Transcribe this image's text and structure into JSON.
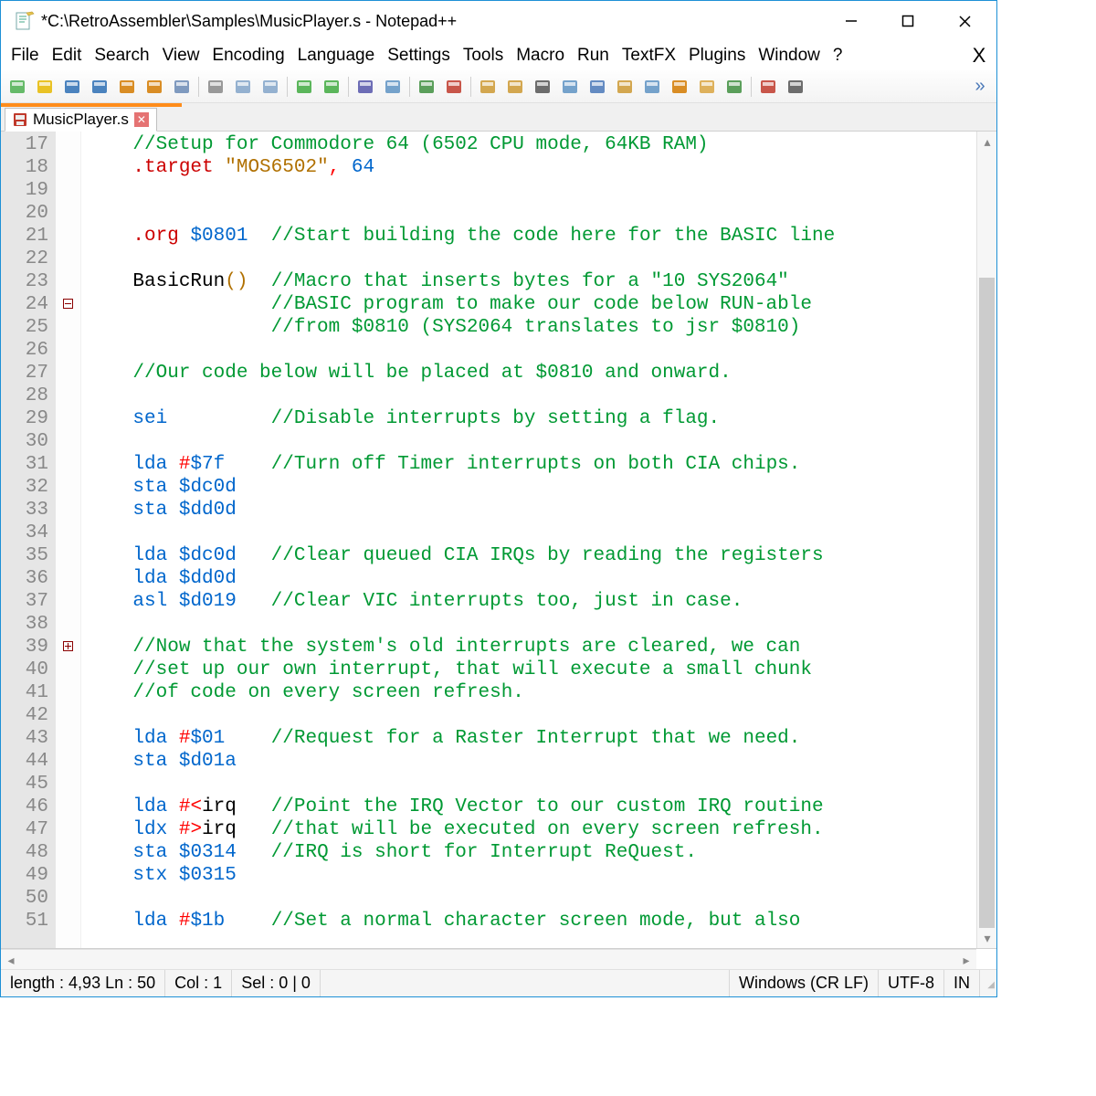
{
  "window": {
    "title": "*C:\\RetroAssembler\\Samples\\MusicPlayer.s - Notepad++"
  },
  "menu": {
    "items": [
      "File",
      "Edit",
      "Search",
      "View",
      "Encoding",
      "Language",
      "Settings",
      "Tools",
      "Macro",
      "Run",
      "TextFX",
      "Plugins",
      "Window",
      "?"
    ],
    "overflow": "X"
  },
  "toolbar": {
    "icons": [
      "new",
      "open",
      "save",
      "save-all",
      "close",
      "close-all",
      "print",
      "",
      "cut",
      "copy",
      "paste",
      "",
      "undo",
      "redo",
      "",
      "find",
      "replace",
      "",
      "zoom-in",
      "zoom-out",
      "",
      "sync-v",
      "sync-h",
      "wrap",
      "show-all",
      "indent-guides",
      "lang",
      "doc-map",
      "func-list",
      "folder-open",
      "monitor",
      "",
      "record",
      "stop"
    ],
    "overflowGlyph": "»"
  },
  "tab": {
    "name": "MusicPlayer.s"
  },
  "editor": {
    "firstLine": 17,
    "lineCount": 35,
    "foldMarkers": {
      "24": "collapsed",
      "39": "open"
    },
    "code": [
      [
        [
          "    ",
          ""
        ],
        [
          "//Setup for Commodore 64 (6502 CPU mode, 64KB RAM)",
          "cmt"
        ]
      ],
      [
        [
          "    ",
          ""
        ],
        [
          ".target",
          "dir"
        ],
        [
          " ",
          ""
        ],
        [
          "\"MOS6502\"",
          "str"
        ],
        [
          ", ",
          "op"
        ],
        [
          "64",
          "num"
        ]
      ],
      [],
      [],
      [
        [
          "    ",
          ""
        ],
        [
          ".org",
          "dir"
        ],
        [
          " ",
          ""
        ],
        [
          "$0801",
          "num"
        ],
        [
          "  ",
          ""
        ],
        [
          "//Start building the code here for the BASIC line",
          "cmt"
        ]
      ],
      [],
      [
        [
          "    ",
          ""
        ],
        [
          "BasicRun",
          "id"
        ],
        [
          "()",
          "paren"
        ],
        [
          "  ",
          ""
        ],
        [
          "//Macro that inserts bytes for a \"10 SYS2064\"",
          "cmt"
        ]
      ],
      [
        [
          "                ",
          ""
        ],
        [
          "//BASIC program to make our code below RUN-able",
          "cmt"
        ]
      ],
      [
        [
          "                ",
          ""
        ],
        [
          "//from $0810 (SYS2064 translates to jsr $0810)",
          "cmt"
        ]
      ],
      [],
      [
        [
          "    ",
          ""
        ],
        [
          "//Our code below will be placed at $0810 and onward.",
          "cmt"
        ]
      ],
      [],
      [
        [
          "    ",
          ""
        ],
        [
          "sei",
          "kw"
        ],
        [
          "         ",
          ""
        ],
        [
          "//Disable interrupts by setting a flag.",
          "cmt"
        ]
      ],
      [],
      [
        [
          "    ",
          ""
        ],
        [
          "lda",
          "kw"
        ],
        [
          " ",
          ""
        ],
        [
          "#",
          "op"
        ],
        [
          "$7f",
          "num"
        ],
        [
          "    ",
          ""
        ],
        [
          "//Turn off Timer interrupts on both CIA chips.",
          "cmt"
        ]
      ],
      [
        [
          "    ",
          ""
        ],
        [
          "sta",
          "kw"
        ],
        [
          " ",
          ""
        ],
        [
          "$dc0d",
          "num"
        ]
      ],
      [
        [
          "    ",
          ""
        ],
        [
          "sta",
          "kw"
        ],
        [
          " ",
          ""
        ],
        [
          "$dd0d",
          "num"
        ]
      ],
      [],
      [
        [
          "    ",
          ""
        ],
        [
          "lda",
          "kw"
        ],
        [
          " ",
          ""
        ],
        [
          "$dc0d",
          "num"
        ],
        [
          "   ",
          ""
        ],
        [
          "//Clear queued CIA IRQs by reading the registers",
          "cmt"
        ]
      ],
      [
        [
          "    ",
          ""
        ],
        [
          "lda",
          "kw"
        ],
        [
          " ",
          ""
        ],
        [
          "$dd0d",
          "num"
        ]
      ],
      [
        [
          "    ",
          ""
        ],
        [
          "asl",
          "kw"
        ],
        [
          " ",
          ""
        ],
        [
          "$d019",
          "num"
        ],
        [
          "   ",
          ""
        ],
        [
          "//Clear VIC interrupts too, just in case.",
          "cmt"
        ]
      ],
      [],
      [
        [
          "    ",
          ""
        ],
        [
          "//Now that the system's old interrupts are cleared, we can",
          "cmt"
        ]
      ],
      [
        [
          "    ",
          ""
        ],
        [
          "//set up our own interrupt, that will execute a small chunk",
          "cmt"
        ]
      ],
      [
        [
          "    ",
          ""
        ],
        [
          "//of code on every screen refresh.",
          "cmt"
        ]
      ],
      [],
      [
        [
          "    ",
          ""
        ],
        [
          "lda",
          "kw"
        ],
        [
          " ",
          ""
        ],
        [
          "#",
          "op"
        ],
        [
          "$01",
          "num"
        ],
        [
          "    ",
          ""
        ],
        [
          "//Request for a Raster Interrupt that we need.",
          "cmt"
        ]
      ],
      [
        [
          "    ",
          ""
        ],
        [
          "sta",
          "kw"
        ],
        [
          " ",
          ""
        ],
        [
          "$d01a",
          "num"
        ]
      ],
      [],
      [
        [
          "    ",
          ""
        ],
        [
          "lda",
          "kw"
        ],
        [
          " ",
          ""
        ],
        [
          "#<",
          "op"
        ],
        [
          "irq",
          "id"
        ],
        [
          "   ",
          ""
        ],
        [
          "//Point the IRQ Vector to our custom IRQ routine",
          "cmt"
        ]
      ],
      [
        [
          "    ",
          ""
        ],
        [
          "ldx",
          "kw"
        ],
        [
          " ",
          ""
        ],
        [
          "#>",
          "op"
        ],
        [
          "irq",
          "id"
        ],
        [
          "   ",
          ""
        ],
        [
          "//that will be executed on every screen refresh.",
          "cmt"
        ]
      ],
      [
        [
          "    ",
          ""
        ],
        [
          "sta",
          "kw"
        ],
        [
          " ",
          ""
        ],
        [
          "$0314",
          "num"
        ],
        [
          "   ",
          ""
        ],
        [
          "//IRQ is short for Interrupt ReQuest.",
          "cmt"
        ]
      ],
      [
        [
          "    ",
          ""
        ],
        [
          "stx",
          "kw"
        ],
        [
          " ",
          ""
        ],
        [
          "$0315",
          "num"
        ]
      ],
      [],
      [
        [
          "    ",
          ""
        ],
        [
          "lda",
          "kw"
        ],
        [
          " ",
          ""
        ],
        [
          "#",
          "op"
        ],
        [
          "$1b",
          "num"
        ],
        [
          "    ",
          ""
        ],
        [
          "//Set a normal character screen mode, but also",
          "cmt"
        ]
      ]
    ]
  },
  "status": {
    "length": "length : 4,93",
    "line": "Ln : 50",
    "col": "Col : 1",
    "sel": "Sel : 0 | 0",
    "eol": "Windows (CR LF)",
    "enc": "UTF-8",
    "ins": "IN"
  },
  "toolIconMap": {
    "new": "#4caf50",
    "open": "#e6b800",
    "save": "#2d6fb4",
    "save-all": "#2d6fb4",
    "close": "#d37a00",
    "close-all": "#d37a00",
    "print": "#6a8ab5",
    "cut": "#888",
    "copy": "#82a5c9",
    "paste": "#82a5c9",
    "undo": "#3faa3f",
    "redo": "#3faa3f",
    "find": "#5555aa",
    "replace": "#5e93c3",
    "zoom-in": "#3f8f3f",
    "zoom-out": "#c0392b",
    "sync-v": "#cc9933",
    "sync-h": "#cc9933",
    "wrap": "#555",
    "show-all": "#5e93c3",
    "indent-guides": "#4a78b8",
    "lang": "#cc9933",
    "doc-map": "#5e93c3",
    "func-list": "#d37a00",
    "folder-open": "#d9a441",
    "monitor": "#3f8f3f",
    "record": "#c0392b",
    "stop": "#555"
  }
}
